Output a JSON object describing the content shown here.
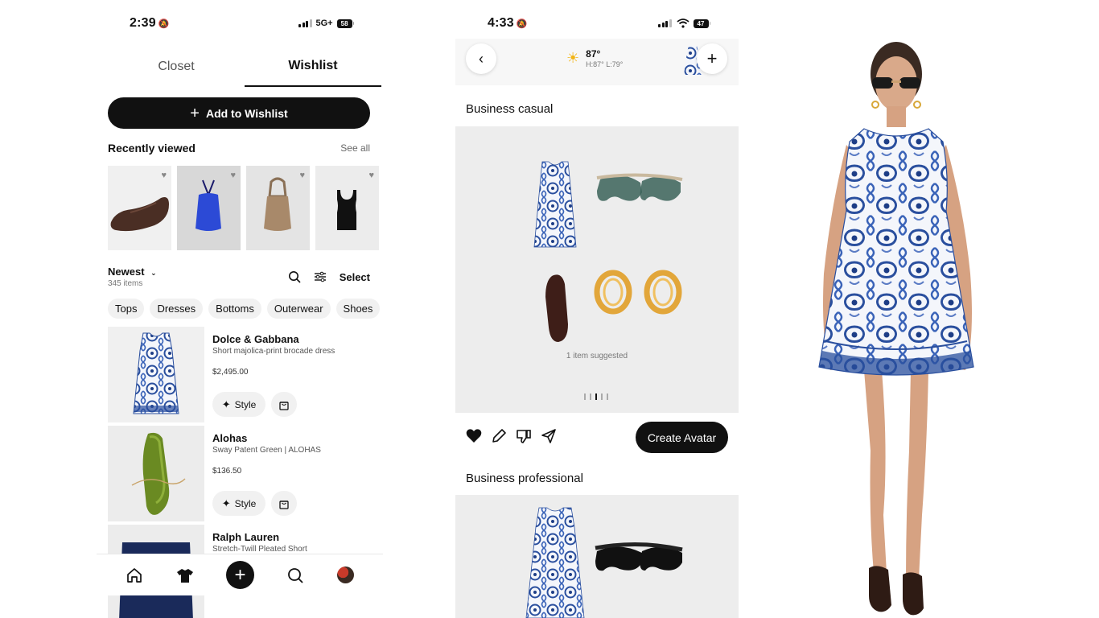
{
  "screen1": {
    "status": {
      "time": "2:39",
      "network": "5G+",
      "battery": "58"
    },
    "tabs": [
      {
        "label": "Closet"
      },
      {
        "label": "Wishlist"
      }
    ],
    "add_button": {
      "label": "Add to Wishlist"
    },
    "recently_viewed": {
      "title": "Recently viewed",
      "see_all": "See all"
    },
    "sort": {
      "label": "Newest",
      "count": "345 items",
      "select": "Select"
    },
    "chips": [
      "Tops",
      "Dresses",
      "Bottoms",
      "Outerwear",
      "Shoes"
    ],
    "items": [
      {
        "brand": "Dolce & Gabbana",
        "desc": "Short majolica-print brocade dress",
        "price": "$2,495.00",
        "style": "Style"
      },
      {
        "brand": "Alohas",
        "desc": "Sway Patent Green | ALOHAS",
        "price": "$136.50",
        "style": "Style"
      },
      {
        "brand": "Ralph Lauren",
        "desc": "Stretch-Twill Pleated Short"
      }
    ]
  },
  "screen2": {
    "status": {
      "time": "4:33",
      "battery": "47"
    },
    "weather": {
      "temp": "87°",
      "hilo": "H:87° L:79°"
    },
    "occasions": [
      {
        "title": "Business casual",
        "suggestion": "1 item suggested"
      },
      {
        "title": "Business professional"
      }
    ],
    "create_avatar": "Create Avatar"
  },
  "colors": {
    "accent": "#111111",
    "dress_blue": "#2a4f9e",
    "chip_bg": "#f1f1f1",
    "card_bg": "#ededed"
  }
}
